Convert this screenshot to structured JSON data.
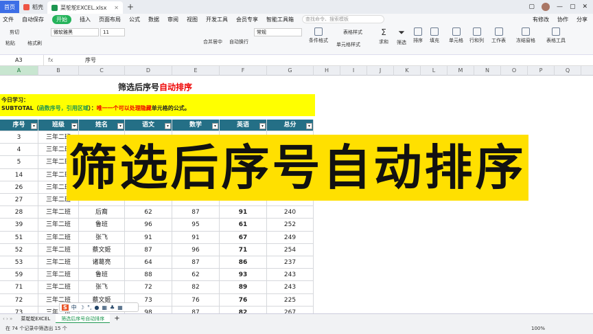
{
  "tabs": [
    {
      "label": "首页"
    },
    {
      "label": "稻壳"
    },
    {
      "label": "菜鸵鸵EXCEL.xlsx"
    }
  ],
  "window": {
    "plus": "+"
  },
  "menu": {
    "file": "文件",
    "autosave": "自动保存",
    "start": "开始",
    "items": [
      "插入",
      "页面布局",
      "公式",
      "数据",
      "审阅",
      "视图",
      "开发工具",
      "会员专享",
      "智能工具箱"
    ],
    "search": "查找命令、搜索模板",
    "unsaved": "有修改",
    "collab": "协作",
    "share": "分享"
  },
  "ribbon": {
    "cut": "剪切",
    "paste": "粘贴",
    "format_painter": "格式刷",
    "font": "微软雅黑",
    "size": "11",
    "normal": "常规",
    "merge": "合并居中",
    "wrap": "自动换行",
    "cond": "条件格式",
    "cellstyle": "单元格样式",
    "sum": "求和",
    "filter": "筛选",
    "sort": "排序",
    "fill": "填充",
    "cell": "单元格",
    "rowcol": "行和列",
    "sheet": "工作表",
    "freeze": "冻结窗格",
    "tabletools": "表格工具",
    "tablestyle": "表格样式"
  },
  "formula": {
    "namebox": "A3",
    "fx": "fx",
    "content": "序号"
  },
  "columns": [
    "A",
    "B",
    "C",
    "D",
    "E",
    "F",
    "G",
    "H",
    "I",
    "J",
    "K",
    "L",
    "M",
    "N",
    "O",
    "P",
    "Q",
    "R"
  ],
  "title": {
    "part1": "筛选后序号",
    "part2": "自动排序"
  },
  "notes": {
    "line1": "今日学习：",
    "line2a": "SUBTOTAL（",
    "line2b": "函数序号，引用区域",
    "line2c": "）：",
    "line2d": "唯一一个可以处理隐藏",
    "line2e": "单元格的公式。"
  },
  "headers": [
    "序号",
    "班级",
    "姓名",
    "语文",
    "数学",
    "英语",
    "总分"
  ],
  "rows": [
    [
      "3",
      "三年二班",
      "",
      "",
      "",
      "",
      ""
    ],
    [
      "4",
      "三年二班",
      "",
      "",
      "",
      "",
      ""
    ],
    [
      "5",
      "三年二班",
      "",
      "",
      "",
      "",
      ""
    ],
    [
      "14",
      "三年二班",
      "",
      "",
      "",
      "",
      ""
    ],
    [
      "26",
      "三年二班",
      "",
      "",
      "",
      "",
      ""
    ],
    [
      "27",
      "三年二班",
      "",
      "",
      "",
      "",
      ""
    ],
    [
      "28",
      "三年二班",
      "后裔",
      "62",
      "87",
      "91",
      "240"
    ],
    [
      "39",
      "三年二班",
      "鲁班",
      "96",
      "95",
      "61",
      "252"
    ],
    [
      "51",
      "三年二班",
      "张飞",
      "91",
      "91",
      "67",
      "249"
    ],
    [
      "52",
      "三年二班",
      "蔡文姬",
      "87",
      "96",
      "71",
      "254"
    ],
    [
      "53",
      "三年二班",
      "诸葛亮",
      "64",
      "87",
      "86",
      "237"
    ],
    [
      "59",
      "三年二班",
      "鲁班",
      "88",
      "62",
      "93",
      "243"
    ],
    [
      "71",
      "三年二班",
      "张飞",
      "72",
      "82",
      "89",
      "243"
    ],
    [
      "72",
      "三年二班",
      "蔡文姬",
      "73",
      "76",
      "76",
      "225"
    ],
    [
      "73",
      "三年二班",
      "",
      "98",
      "87",
      "82",
      "267"
    ]
  ],
  "banner": {
    "text": "筛选后序号自动排序"
  },
  "sheettabs": [
    "菜鸵鸵EXCEL",
    "筛选后序号自动排序"
  ],
  "status": {
    "text": "在 74 个记录中筛选出 15 个",
    "zoom": "100%"
  },
  "floattool": {
    "logo": "S",
    "lang": "中"
  },
  "colors": {
    "header": "#246f86",
    "banner": "#ffe000",
    "note": "#ffff00",
    "accent": "#24b35a"
  }
}
